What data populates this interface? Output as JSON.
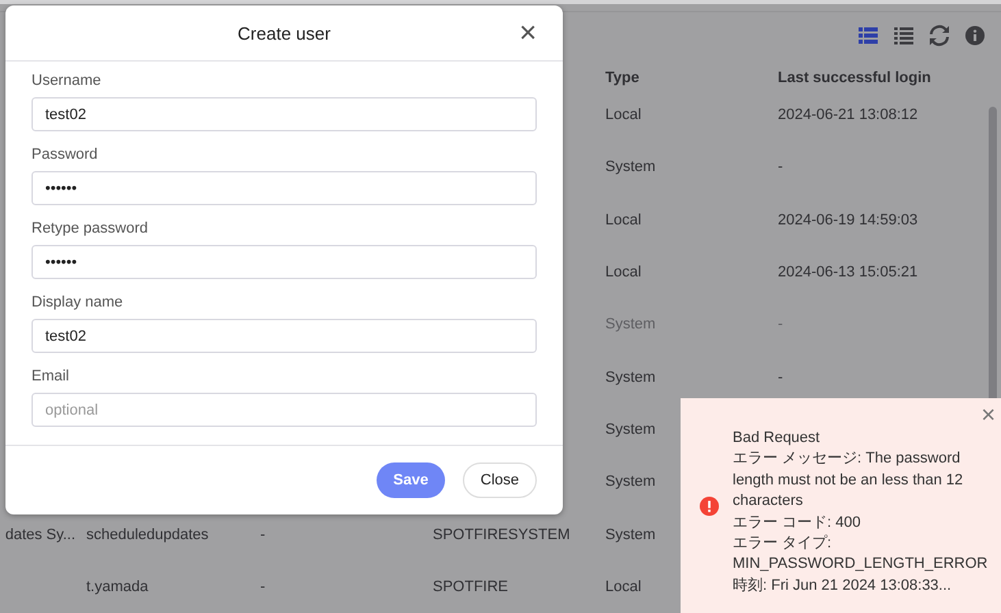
{
  "toolbar": {
    "icons": [
      {
        "kind": "grid",
        "selected": true
      },
      {
        "kind": "list",
        "selected": false
      },
      {
        "kind": "refresh",
        "selected": false
      },
      {
        "kind": "info",
        "selected": false
      }
    ]
  },
  "table": {
    "columns": [
      "Type",
      "Last successful login"
    ],
    "rows": [
      {
        "type": "Local",
        "last_login": "2024-06-21 13:08:12",
        "disabled": false
      },
      {
        "type": "System",
        "last_login": "-",
        "disabled": false
      },
      {
        "type": "Local",
        "last_login": "2024-06-19 14:59:03",
        "disabled": false
      },
      {
        "type": "Local",
        "last_login": "2024-06-13 15:05:21",
        "disabled": false
      },
      {
        "type": "System",
        "last_login": "-",
        "disabled": true
      },
      {
        "type": "System",
        "last_login": "-",
        "disabled": false
      },
      {
        "type": "System",
        "disabled": false
      },
      {
        "type": "System",
        "disabled": false
      },
      {
        "column_1": "dates Sy...",
        "column_2": "scheduledupdates",
        "column_3": "-",
        "column_4": "SPOTFIRESYSTEM",
        "type": "System",
        "disabled": false
      },
      {
        "column_2": "t.yamada",
        "column_3": "-",
        "column_4": "SPOTFIRE",
        "type": "Local",
        "disabled": false
      }
    ]
  },
  "dialog": {
    "title": "Create user",
    "close": "×",
    "fields": [
      {
        "label": "Username",
        "value": "test02"
      },
      {
        "label": "Password",
        "value": "••••••"
      },
      {
        "label": "Retype password",
        "value": "••••••"
      },
      {
        "label": "Display name",
        "value": "test02"
      },
      {
        "label": "Email",
        "placeholder": "optional"
      }
    ],
    "buttons": [
      {
        "label": "Save",
        "kind": "primary"
      },
      {
        "label": "Close",
        "kind": "secondary"
      }
    ]
  },
  "toast": {
    "close": "×",
    "lines": [
      "Bad Request",
      "エラー メッセージ: The password length must not be an less than 12 characters",
      "エラー コード: 400",
      "エラー タイプ: MIN_PASSWORD_LENGTH_ERROR",
      "時刻: Fri Jun 21 2024 13:08:33..."
    ]
  }
}
